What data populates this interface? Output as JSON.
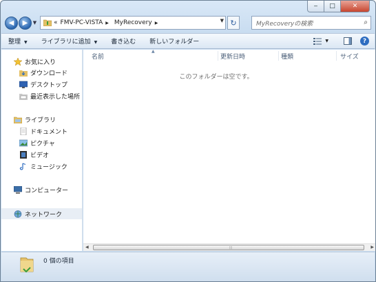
{
  "window": {
    "caption": {
      "minimize": "‒",
      "maximize": "□",
      "close": "✕"
    }
  },
  "address_bar": {
    "overflow": "«",
    "breadcrumbs": [
      "FMV-PC-VISTA",
      "MyRecovery"
    ]
  },
  "search": {
    "placeholder": "MyRecoveryの検索"
  },
  "toolbar": {
    "organize": "整理",
    "add_to_library": "ライブラリに追加",
    "burn": "書き込む",
    "new_folder": "新しいフォルダー"
  },
  "nav": {
    "favorites": "お気に入り",
    "downloads": "ダウンロード",
    "desktop": "デスクトップ",
    "recent": "最近表示した場所",
    "libraries": "ライブラリ",
    "documents": "ドキュメント",
    "pictures": "ピクチャ",
    "videos": "ビデオ",
    "music": "ミュージック",
    "computer": "コンピューター",
    "network": "ネットワーク"
  },
  "columns": {
    "name": "名前",
    "date": "更新日時",
    "type": "種類",
    "size": "サイズ"
  },
  "content": {
    "empty_message": "このフォルダーは空です。"
  },
  "details": {
    "item_count": "0 個の項目"
  },
  "scrollbar": {
    "grip": "⦙⦙⦙"
  }
}
